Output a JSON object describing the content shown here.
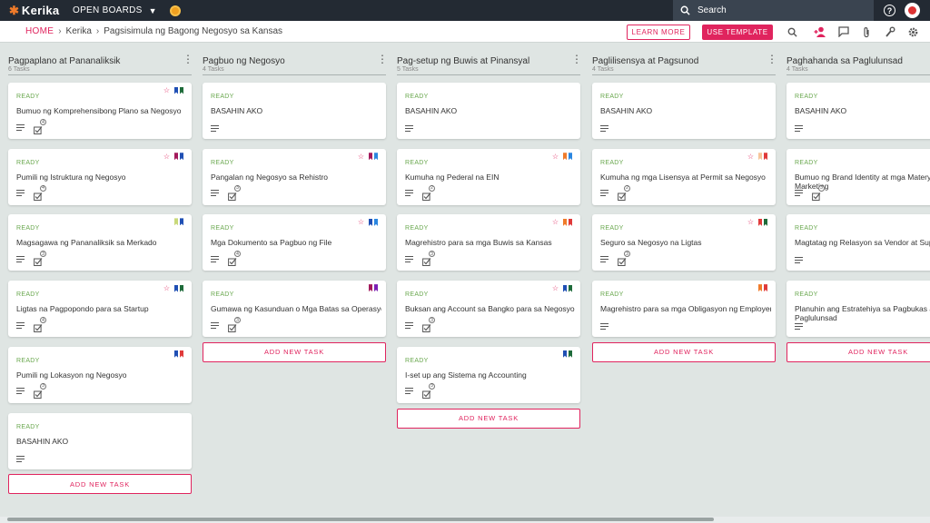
{
  "topbar": {
    "logo": "Kerika",
    "open_boards": "OPEN BOARDS",
    "search_placeholder": "Search",
    "help_icon": "?"
  },
  "breadcrumb": {
    "home": "HOME",
    "items": [
      "Kerika",
      "Pagsisimula ng Bagong Negosyo sa Kansas"
    ]
  },
  "actions": {
    "learn_more": "LEARN MORE",
    "use_template": "USE TEMPLATE"
  },
  "icons": [
    "search-icon",
    "add-person-icon",
    "chat-icon",
    "attachment-icon",
    "wrench-icon",
    "gear-icon"
  ],
  "colors": {
    "accent": "#e0245e",
    "ready": "#6aa84f",
    "topbar": "#232a33",
    "board": "#dfe5e3"
  },
  "columns": [
    {
      "title": "Pagpaplano at Pananaliksik",
      "count": "6 Tasks",
      "add_label": "ADD NEW TASK",
      "cards": [
        {
          "status": "READY",
          "title": "Bumuo ng Komprehensibong Plano sa Negosyo",
          "checks": "4",
          "star": true,
          "flags": [
            "#1f4fb4",
            "#1e6b3a"
          ]
        },
        {
          "status": "READY",
          "title": "Pumili ng Istruktura ng Negosyo",
          "checks": "4",
          "star": true,
          "flags": [
            "#a3195b",
            "#1f4fb4"
          ]
        },
        {
          "status": "READY",
          "title": "Magsagawa ng Pananaliksik sa Merkado",
          "checks": "3",
          "star": false,
          "flags": [
            "#c9d97a",
            "#1f4fb4"
          ]
        },
        {
          "status": "READY",
          "title": "Ligtas na Pagpopondo para sa Startup",
          "checks": "4",
          "star": true,
          "flags": [
            "#1f4fb4",
            "#1e6b3a"
          ]
        },
        {
          "status": "READY",
          "title": "Pumili ng Lokasyon ng Negosyo",
          "checks": "3",
          "star": false,
          "flags": [
            "#1f4fb4",
            "#e03a3a"
          ]
        },
        {
          "status": "READY",
          "title": "BASAHIN AKO",
          "checks": "",
          "star": false,
          "flags": []
        }
      ]
    },
    {
      "title": "Pagbuo ng Negosyo",
      "count": "4 Tasks",
      "add_label": "ADD NEW TASK",
      "cards": [
        {
          "status": "READY",
          "title": "BASAHIN AKO",
          "checks": "",
          "star": false,
          "flags": []
        },
        {
          "status": "READY",
          "title": "Pangalan ng Negosyo sa Rehistro",
          "checks": "3",
          "star": true,
          "flags": [
            "#a3195b",
            "#2a86e0"
          ]
        },
        {
          "status": "READY",
          "title": "Mga Dokumento sa Pagbuo ng File",
          "checks": "4",
          "star": true,
          "flags": [
            "#1f4fb4",
            "#2a86e0"
          ]
        },
        {
          "status": "READY",
          "title": "Gumawa ng Kasunduan o Mga Batas sa Operasyon",
          "checks": "3",
          "star": false,
          "flags": [
            "#a3195b",
            "#7a1fb4"
          ]
        }
      ]
    },
    {
      "title": "Pag-setup ng Buwis at Pinansyal",
      "count": "5 Tasks",
      "add_label": "ADD NEW TASK",
      "cards": [
        {
          "status": "READY",
          "title": "BASAHIN AKO",
          "checks": "",
          "star": false,
          "flags": []
        },
        {
          "status": "READY",
          "title": "Kumuha ng Pederal na EIN",
          "checks": "2",
          "star": true,
          "flags": [
            "#f07b2a",
            "#2a86e0"
          ]
        },
        {
          "status": "READY",
          "title": "Magrehistro para sa mga Buwis sa Kansas",
          "checks": "3",
          "star": true,
          "flags": [
            "#f07b2a",
            "#e03a3a"
          ]
        },
        {
          "status": "READY",
          "title": "Buksan ang Account sa Bangko para sa Negosyo",
          "checks": "3",
          "star": true,
          "flags": [
            "#1f4fb4",
            "#1e6b3a"
          ]
        },
        {
          "status": "READY",
          "title": "I-set up ang Sistema ng Accounting",
          "checks": "3",
          "star": false,
          "flags": [
            "#1f4fb4",
            "#1e6b3a"
          ]
        }
      ]
    },
    {
      "title": "Paglilisensya at Pagsunod",
      "count": "4 Tasks",
      "add_label": "ADD NEW TASK",
      "cards": [
        {
          "status": "READY",
          "title": "BASAHIN AKO",
          "checks": "",
          "star": false,
          "flags": []
        },
        {
          "status": "READY",
          "title": "Kumuha ng mga Lisensya at Permit sa Negosyo",
          "checks": "2",
          "star": true,
          "flags": [
            "#f7c59a",
            "#e03a3a"
          ]
        },
        {
          "status": "READY",
          "title": "Seguro sa Negosyo na Ligtas",
          "checks": "3",
          "star": true,
          "flags": [
            "#e03a3a",
            "#1e6b3a"
          ]
        },
        {
          "status": "READY",
          "title": "Magrehistro para sa mga Obligasyon ng Employer",
          "checks": "",
          "star": false,
          "flags": [
            "#f07b2a",
            "#e03a3a"
          ]
        }
      ]
    },
    {
      "title": "Paghahanda sa Paglulunsad",
      "count": "4 Tasks",
      "add_label": "ADD NEW TASK",
      "cards": [
        {
          "status": "READY",
          "title": "BASAHIN AKO",
          "checks": "",
          "star": false,
          "flags": []
        },
        {
          "status": "READY",
          "title": "Bumuo ng Brand Identity at mga Materyales sa Marketing",
          "checks": "3",
          "star": false,
          "flags": []
        },
        {
          "status": "READY",
          "title": "Magtatag ng Relasyon sa Vendor at Supplier",
          "checks": "",
          "star": false,
          "flags": []
        },
        {
          "status": "READY",
          "title": "Planuhin ang Estratehiya sa Pagbukas at Paglulunsad",
          "checks": "",
          "star": false,
          "flags": []
        }
      ]
    }
  ]
}
